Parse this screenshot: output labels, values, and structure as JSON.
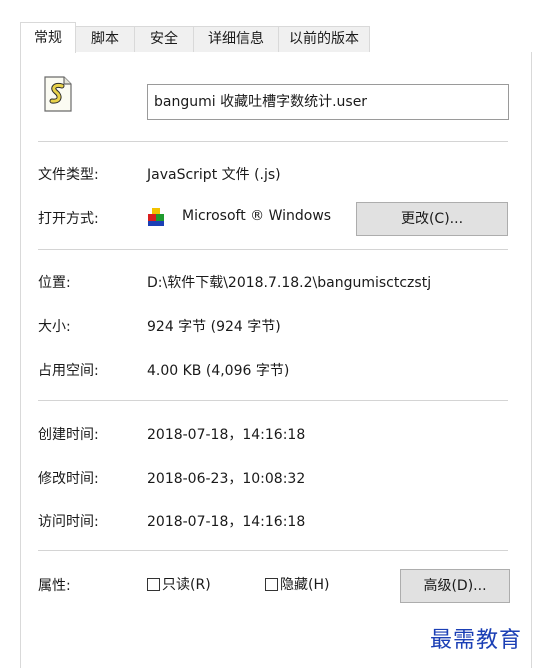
{
  "tabs": [
    {
      "label": "常规",
      "active": true
    },
    {
      "label": "脚本",
      "active": false
    },
    {
      "label": "安全",
      "active": false
    },
    {
      "label": "详细信息",
      "active": false
    },
    {
      "label": "以前的版本",
      "active": false
    }
  ],
  "file": {
    "name": "bangumi 收藏吐槽字数统计.user",
    "icon": "script-file-icon"
  },
  "rows": {
    "type": {
      "label": "文件类型:",
      "value": "JavaScript 文件 (.js)"
    },
    "opens_with": {
      "label": "打开方式:",
      "value": "Microsoft ® Windows",
      "app_icon": "windows-script-host-icon",
      "change_button": "更改(C)..."
    },
    "location": {
      "label": "位置:",
      "value": "D:\\软件下载\\2018.7.18.2\\bangumisctczstj"
    },
    "size": {
      "label": "大小:",
      "value": "924 字节 (924 字节)"
    },
    "size_on_disk": {
      "label": "占用空间:",
      "value": "4.00 KB (4,096 字节)"
    },
    "created": {
      "label": "创建时间:",
      "value": "2018-07-18，14:16:18"
    },
    "modified": {
      "label": "修改时间:",
      "value": "2018-06-23，10:08:32"
    },
    "accessed": {
      "label": "访问时间:",
      "value": "2018-07-18，14:16:18"
    }
  },
  "attributes": {
    "label": "属性:",
    "readonly": {
      "label": "只读(R)",
      "checked": false
    },
    "hidden": {
      "label": "隐藏(H)",
      "checked": false
    },
    "advanced_button": "高级(D)..."
  },
  "watermark": "最需教育",
  "colors": {
    "watermark": "#1b3fb5",
    "separator": "#d4d4d4",
    "button_bg": "#e1e1e1"
  }
}
